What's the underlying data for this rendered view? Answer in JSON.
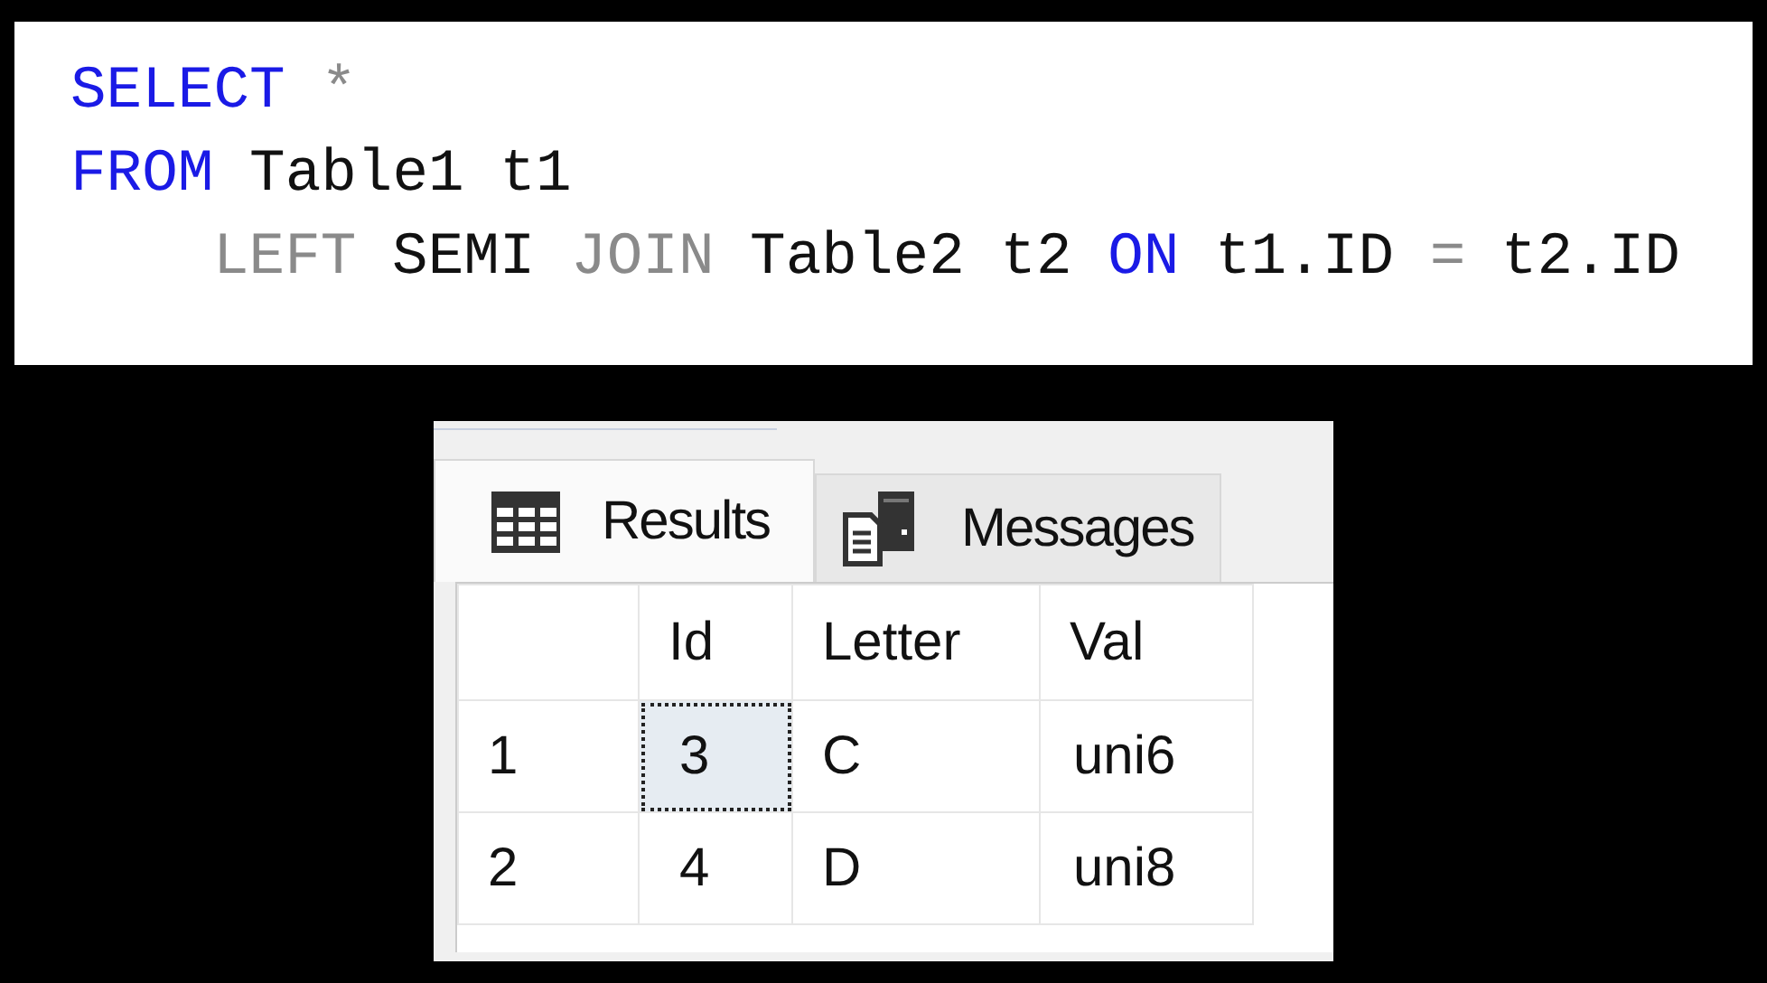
{
  "editor": {
    "lines": [
      {
        "indented": false,
        "tokens": [
          {
            "text": "SELECT",
            "kind": "keyword"
          },
          {
            "text": "*",
            "kind": "operator"
          }
        ]
      },
      {
        "indented": false,
        "tokens": [
          {
            "text": "FROM",
            "kind": "keyword"
          },
          {
            "text": "Table1",
            "kind": "text"
          },
          {
            "text": "t1",
            "kind": "text"
          }
        ]
      },
      {
        "indented": true,
        "tokens": [
          {
            "text": "LEFT",
            "kind": "operator"
          },
          {
            "text": "SEMI",
            "kind": "text"
          },
          {
            "text": "JOIN",
            "kind": "operator"
          },
          {
            "text": "Table2",
            "kind": "text"
          },
          {
            "text": "t2",
            "kind": "text"
          },
          {
            "text": "ON",
            "kind": "keyword"
          },
          {
            "text": "t1.ID",
            "kind": "text"
          },
          {
            "text": "=",
            "kind": "operator"
          },
          {
            "text": "t2.ID",
            "kind": "text"
          }
        ]
      }
    ]
  },
  "results": {
    "tabs": [
      {
        "label": "Results",
        "kind": "grid",
        "selected": true
      },
      {
        "label": "Messages",
        "kind": "messages",
        "selected": false
      }
    ],
    "columns": [
      "Id",
      "Letter",
      "Val"
    ],
    "rows": [
      {
        "number": "1",
        "cells": [
          {
            "text": "3",
            "selected": true
          },
          {
            "text": "C",
            "selected": false
          },
          {
            "text": "uni6",
            "selected": false
          }
        ]
      },
      {
        "number": "2",
        "cells": [
          {
            "text": "4",
            "selected": false
          },
          {
            "text": "D",
            "selected": false
          },
          {
            "text": "uni8",
            "selected": false
          }
        ]
      }
    ]
  }
}
